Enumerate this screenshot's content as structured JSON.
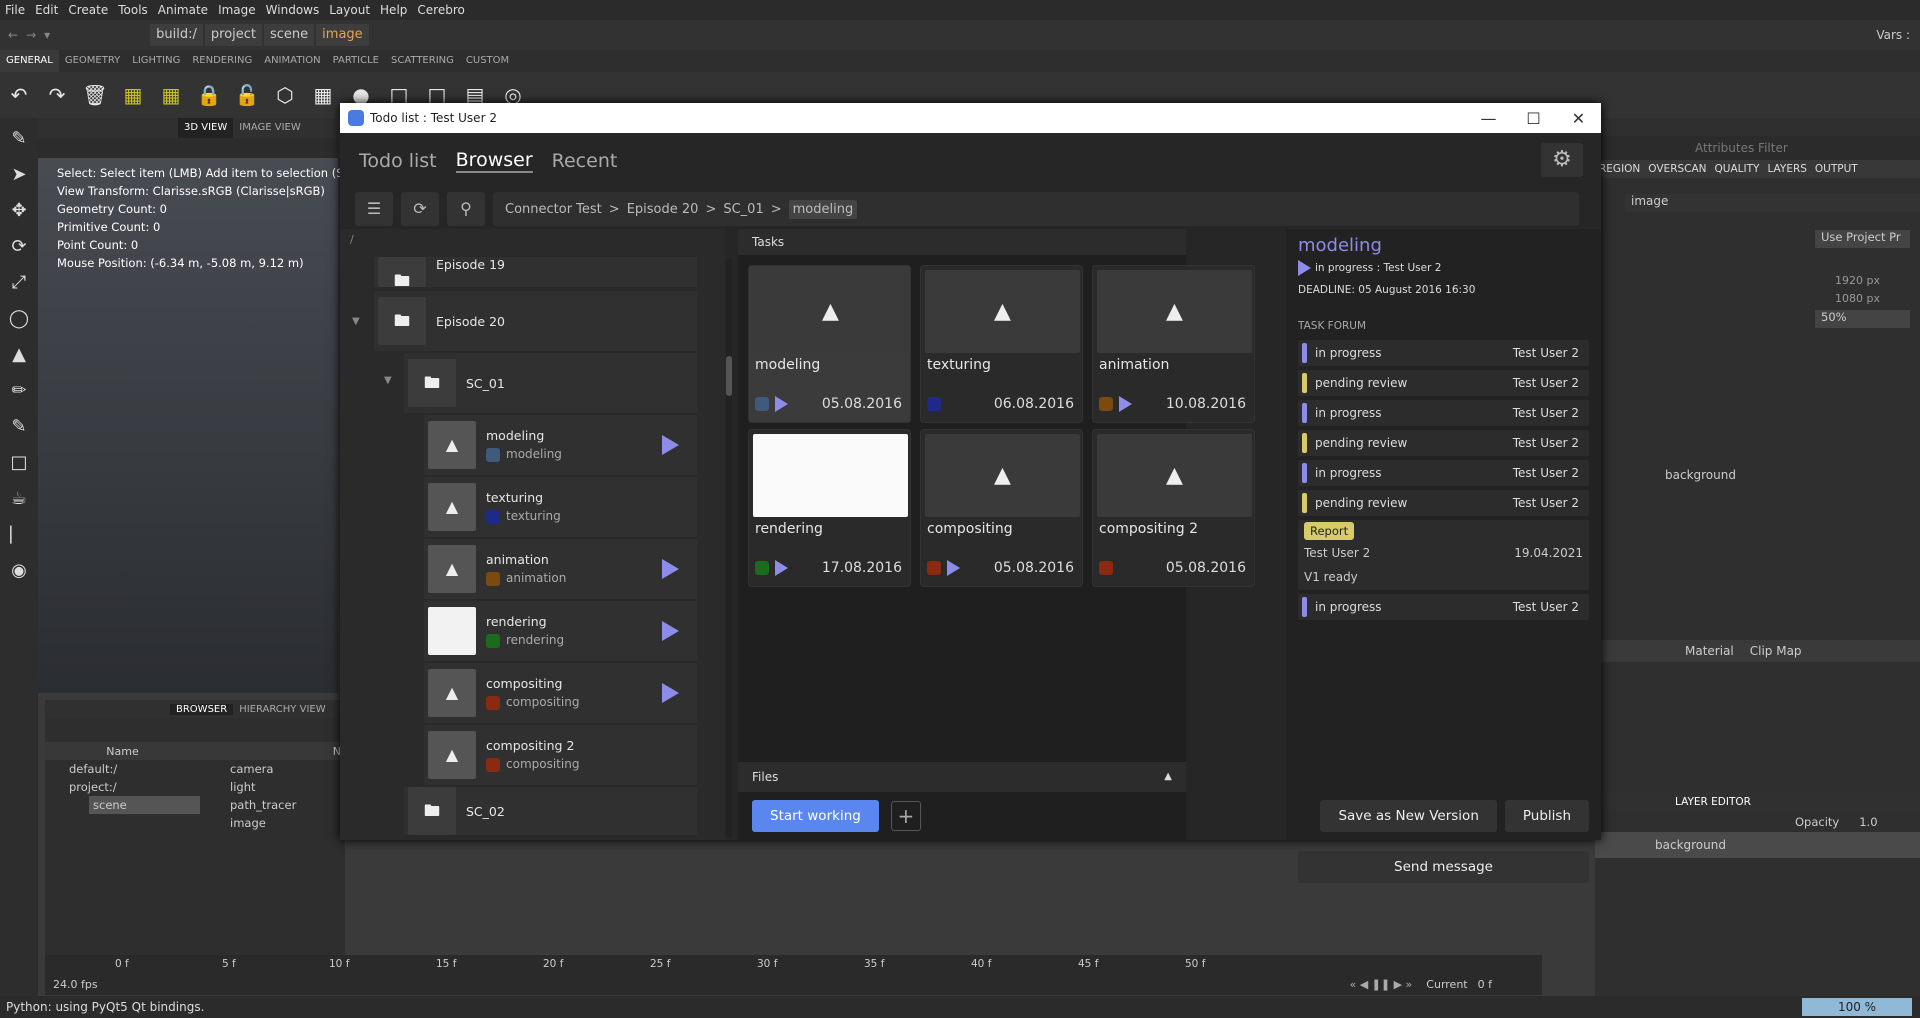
{
  "menu": [
    "File",
    "Edit",
    "Create",
    "Tools",
    "Animate",
    "Image",
    "Windows",
    "Layout",
    "Help",
    "Cerebro"
  ],
  "path": {
    "build": "build:/",
    "project": "project",
    "scene": "scene",
    "image": "image",
    "vars": "Vars :"
  },
  "shelf_tabs": [
    "GENERAL",
    "GEOMETRY",
    "LIGHTING",
    "RENDERING",
    "ANIMATION",
    "PARTICLE",
    "SCATTERING",
    "CUSTOM"
  ],
  "viewport": {
    "tabs": [
      "3D VIEW",
      "IMAGE VIEW"
    ],
    "info": [
      "Select: Select item (LMB)  Add item to selection (Shi",
      "View Transform: Clarisse.sRGB (Clarisse|sRGB)",
      "Geometry Count: 0",
      "Primitive Count: 0",
      "Point Count: 0",
      "Mouse Position:  (-6.34 m, -5.08 m, 9.12 m)"
    ]
  },
  "browser": {
    "tabs": [
      "BROWSER",
      "HIERARCHY VIEW"
    ],
    "col_name": "Name",
    "col_n": "N",
    "tree": [
      "default:/",
      "project:/",
      "scene"
    ],
    "items": [
      "camera",
      "light",
      "path_tracer",
      "image"
    ]
  },
  "timeline": {
    "labels": [
      "0 f",
      "5 f",
      "10 f",
      "15 f",
      "20 f",
      "25 f",
      "30 f",
      "35 f",
      "40 f",
      "45 f",
      "50 f"
    ],
    "fps": "24.0 fps",
    "current_label": "Current",
    "current": "0 f",
    "end": "50 f",
    "start": "0 f"
  },
  "status": {
    "text": "Python: using PyQt5 Qt bindings.",
    "zoom": "100 %"
  },
  "right": {
    "filter": "Attributes Filter",
    "tabs": [
      "REGION",
      "OVERSCAN",
      "QUALITY",
      "LAYERS",
      "OUTPUT"
    ],
    "image": "image",
    "mode_label": "Use Project Pr",
    "res": [
      "1920 px",
      "1080 px"
    ],
    "multiplier": "50%",
    "background": "background",
    "layer_editor": "LAYER EDITOR",
    "opacity_label": "Opacity",
    "opacity": "1.0",
    "filter2": "Filter",
    "subtabs": [
      "Material",
      "Clip Map"
    ]
  },
  "dialog": {
    "title": "Todo list : Test User 2",
    "tabs": [
      "Todo list",
      "Browser",
      "Recent"
    ],
    "crumbs": [
      "Connector Test",
      "Episode 20",
      "SC_01",
      "modeling"
    ],
    "root": "/",
    "tree": {
      "ep19": "Episode 19",
      "ep20": "Episode 20",
      "sc01": "SC_01",
      "sc02": "SC_02",
      "tasks": [
        {
          "name": "modeling",
          "sub": "modeling",
          "color": "#3f5a7a",
          "play": true
        },
        {
          "name": "texturing",
          "sub": "texturing",
          "color": "#1e2a8a",
          "play": false
        },
        {
          "name": "animation",
          "sub": "animation",
          "color": "#7a4a10",
          "play": true
        },
        {
          "name": "rendering",
          "sub": "rendering",
          "color": "#1c6b1c",
          "play": true
        },
        {
          "name": "compositing",
          "sub": "compositing",
          "color": "#8a2a10",
          "play": true
        },
        {
          "name": "compositing 2",
          "sub": "compositing",
          "color": "#8a2a10",
          "play": false
        }
      ]
    },
    "tasks_header": "Tasks",
    "cards": [
      {
        "name": "modeling",
        "date": "05.08.2016",
        "color": "#3f5a7a",
        "play": true
      },
      {
        "name": "texturing",
        "date": "06.08.2016",
        "color": "#1e2a8a",
        "play": false
      },
      {
        "name": "animation",
        "date": "10.08.2016",
        "color": "#7a4a10",
        "play": true
      },
      {
        "name": "rendering",
        "date": "17.08.2016",
        "color": "#1c6b1c",
        "play": true
      },
      {
        "name": "compositing",
        "date": "05.08.2016",
        "color": "#8a2a10",
        "play": true
      },
      {
        "name": "compositing 2",
        "date": "05.08.2016",
        "color": "#8a2a10",
        "play": false
      }
    ],
    "files": "Files",
    "start_working": "Start working",
    "save_version": "Save as New Version",
    "publish": "Publish",
    "send_message": "Send message",
    "detail": {
      "name": "modeling",
      "status": "in progress : Test User 2",
      "deadline": "DEADLINE: 05 August 2016 16:30",
      "forum_label": "TASK FORUM",
      "forum": [
        {
          "s": "in progress",
          "u": "Test User 2",
          "c": "#8d8ce8"
        },
        {
          "s": "pending review",
          "u": "Test User 2",
          "c": "#d8cc6a"
        },
        {
          "s": "in progress",
          "u": "Test User 2",
          "c": "#8d8ce8"
        },
        {
          "s": "pending review",
          "u": "Test User 2",
          "c": "#d8cc6a"
        },
        {
          "s": "in progress",
          "u": "Test User 2",
          "c": "#8d8ce8"
        },
        {
          "s": "pending review",
          "u": "Test User 2",
          "c": "#d8cc6a"
        }
      ],
      "report": {
        "tag": "Report",
        "user": "Test User 2",
        "date": "19.04.2021",
        "text": "V1 ready"
      },
      "last": {
        "s": "in progress",
        "u": "Test User 2"
      }
    }
  }
}
